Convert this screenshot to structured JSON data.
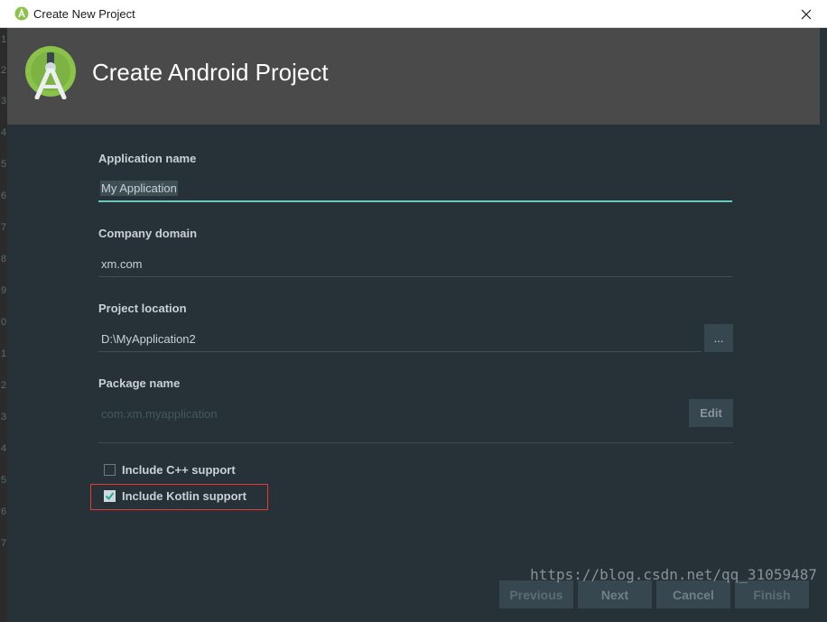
{
  "window": {
    "title": "Create New Project"
  },
  "header": {
    "title": "Create Android Project"
  },
  "fields": {
    "app_name": {
      "label": "Application name",
      "value": "My Application"
    },
    "company_domain": {
      "label": "Company domain",
      "value": "xm.com"
    },
    "project_location": {
      "label": "Project location",
      "value": "D:\\MyApplication2",
      "browse_label": "..."
    },
    "package_name": {
      "label": "Package name",
      "value": "com.xm.myapplication",
      "edit_label": "Edit"
    }
  },
  "options": {
    "cpp": {
      "label": "Include C++ support",
      "checked": false
    },
    "kotlin": {
      "label": "Include Kotlin support",
      "checked": true
    }
  },
  "footer": {
    "previous": "Previous",
    "next": "Next",
    "cancel": "Cancel",
    "finish": "Finish"
  },
  "watermark": "https://blog.csdn.net/qq_31059487",
  "background_line_numbers": [
    "6",
    "1",
    "2",
    "3",
    "4",
    "5",
    "6",
    "7",
    "8",
    "9",
    "0",
    "1",
    "2",
    "3",
    "4",
    "5",
    "6",
    "7"
  ],
  "colors": {
    "accent": "#67c8bb",
    "android_green": "#8bc34a",
    "highlight": "#e53935"
  }
}
